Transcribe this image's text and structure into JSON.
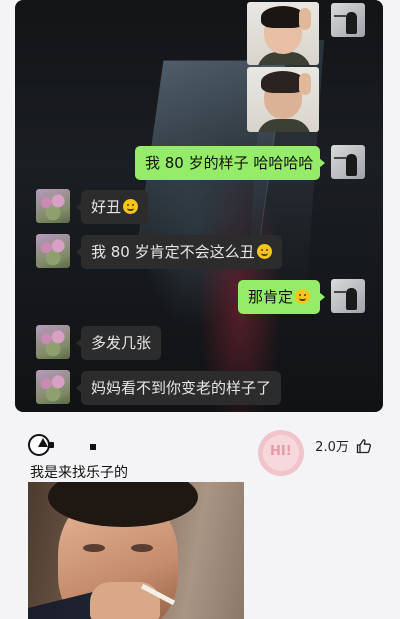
{
  "chat": {
    "messages": [
      {
        "from": "me",
        "type": "image",
        "alt": ""
      },
      {
        "from": "me",
        "type": "image",
        "alt": ""
      },
      {
        "from": "me",
        "type": "text",
        "text": "我 80 岁的样子 哈哈哈哈"
      },
      {
        "from": "mom",
        "type": "text",
        "text": "好丑",
        "emoji": "smile-emoji"
      },
      {
        "from": "mom",
        "type": "text",
        "text": "我 80 岁肯定不会这么丑",
        "emoji": "grin-emoji"
      },
      {
        "from": "me",
        "type": "text",
        "text": "那肯定",
        "emoji": "smile-emoji"
      },
      {
        "from": "mom",
        "type": "text",
        "text": "多发几张"
      },
      {
        "from": "mom",
        "type": "text",
        "text": "妈妈看不到你变老的样子了"
      }
    ],
    "colors": {
      "sent_bubble": "#95ec69",
      "recv_bubble": "#2c2c2c"
    }
  },
  "comment": {
    "likes": "2.0万",
    "like_icon": "thumbs-up-icon",
    "text": "我是来找乐子的",
    "stamp_text": "HI!",
    "image": "crying-man-meme"
  }
}
